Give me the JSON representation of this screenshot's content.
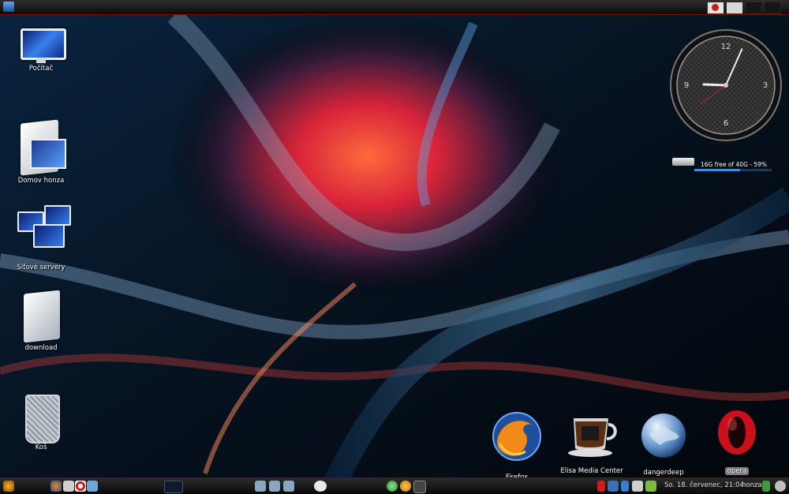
{
  "desktop": {
    "icons": [
      {
        "label": "Počítač",
        "icon": "computer-icon"
      },
      {
        "label": "Domov honza",
        "icon": "home-folder-icon"
      },
      {
        "label": "Síťové servery",
        "icon": "network-servers-icon"
      },
      {
        "label": "download",
        "icon": "folder-icon"
      },
      {
        "label": "Koš",
        "icon": "trash-icon"
      }
    ]
  },
  "widgets": {
    "clock": {
      "numerals": [
        "12",
        "3",
        "6",
        "9"
      ],
      "hour": 9,
      "minute": 4
    },
    "disk": {
      "text": "16G free of 40G - 59%",
      "used_fraction": 0.59
    }
  },
  "dock": {
    "items": [
      {
        "label": "Firefox",
        "icon": "firefox-icon"
      },
      {
        "label": "Elisa Media Center",
        "icon": "coffee-cup-icon"
      },
      {
        "label": "dangerdeep",
        "icon": "globe-icon"
      },
      {
        "label": "opera",
        "icon": "opera-icon"
      }
    ]
  },
  "bottom_panel": {
    "clock": "So. 18. červenec, 21:04",
    "user": "honza"
  },
  "colors": {
    "panel_accent": "#7a1010",
    "firefox_orange": "#f28a1a",
    "opera_red": "#c9101b"
  }
}
